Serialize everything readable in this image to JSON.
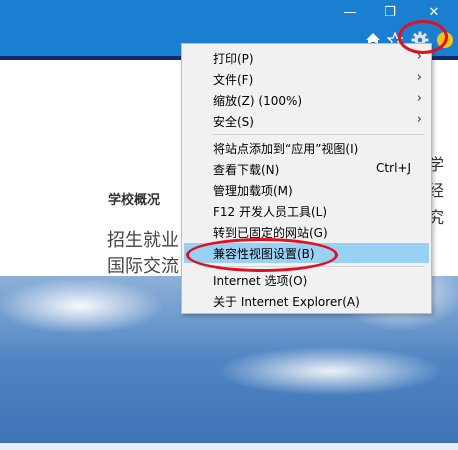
{
  "window": {
    "minimize_glyph": "—",
    "restore_glyph": "❐",
    "close_glyph": "✕"
  },
  "toolbar": {
    "icons": [
      "home-icon",
      "favorites-star-icon",
      "tools-gear-icon",
      "feedback-smiley-icon"
    ]
  },
  "page": {
    "section_title": "学校概况",
    "links": [
      "招生就业",
      "国际交流"
    ],
    "right_edge_text": [
      "学",
      "经",
      "究"
    ]
  },
  "menu": {
    "items": [
      {
        "label": "打印(P)",
        "submenu": true
      },
      {
        "label": "文件(F)",
        "submenu": true
      },
      {
        "label": "缩放(Z) (100%)",
        "submenu": true
      },
      {
        "label": "安全(S)",
        "submenu": true
      },
      {
        "label": "将站点添加到“应用”视图(I)"
      },
      {
        "label": "查看下载(N)",
        "shortcut": "Ctrl+J"
      },
      {
        "label": "管理加载项(M)"
      },
      {
        "label": "F12 开发人员工具(L)"
      },
      {
        "label": "转到已固定的网站(G)"
      },
      {
        "label": "兼容性视图设置(B)",
        "highlighted": true
      },
      {
        "label": "Internet 选项(O)"
      },
      {
        "label": "关于 Internet Explorer(A)"
      }
    ],
    "arrow_glyph": "›"
  },
  "colors": {
    "titlebar": "#1a7fd0",
    "highlight": "#99d1f4",
    "annotation_red": "#e01020"
  }
}
